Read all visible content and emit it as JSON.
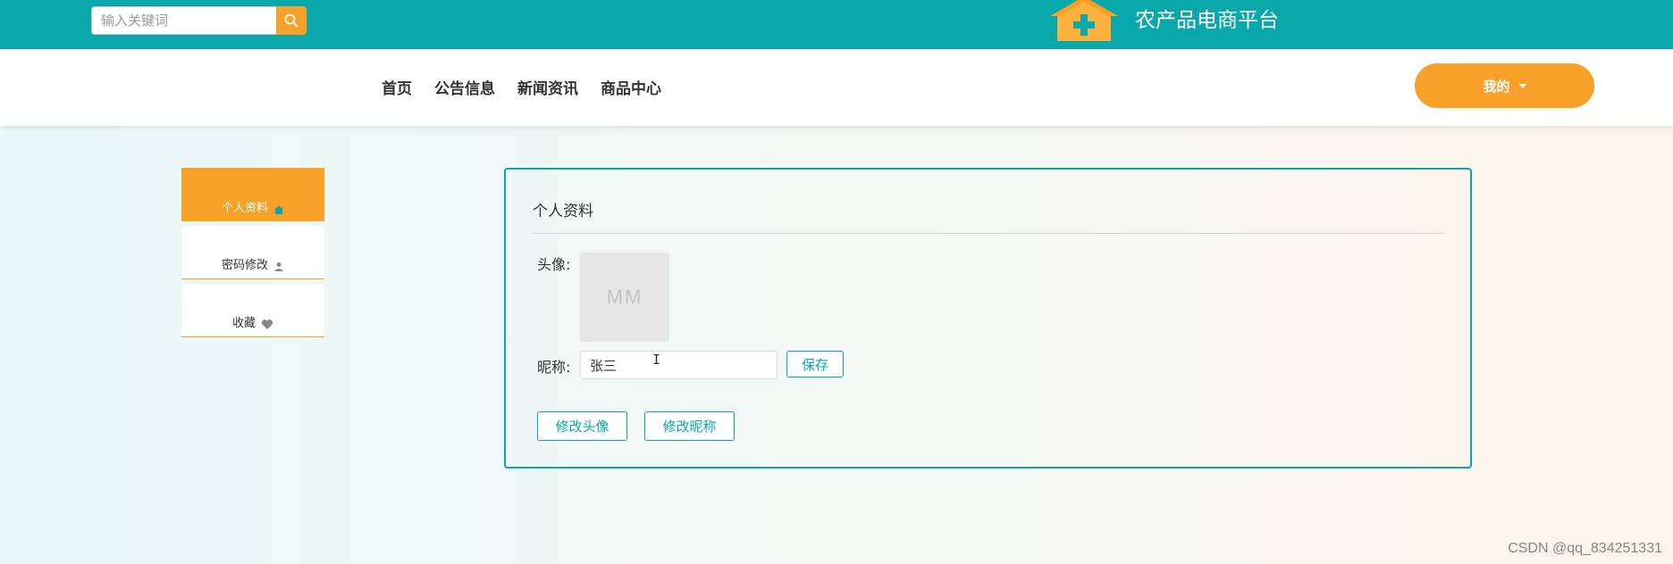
{
  "header": {
    "search_placeholder": "输入关键词",
    "search_icon": "search-icon",
    "logo_icon": "house-plus-logo",
    "site_title": "农产品电商平台"
  },
  "nav": {
    "items": [
      {
        "label": "首页"
      },
      {
        "label": "公告信息"
      },
      {
        "label": "新闻资讯"
      },
      {
        "label": "商品中心"
      }
    ],
    "user_menu_label": "我的"
  },
  "sidebar": {
    "items": [
      {
        "label": "个人资料",
        "icon": "home-icon",
        "active": true
      },
      {
        "label": "密码修改",
        "icon": "user-icon",
        "active": false
      },
      {
        "label": "收藏",
        "icon": "heart-icon",
        "active": false
      }
    ]
  },
  "profile": {
    "title": "个人资料",
    "avatar_label": "头像:",
    "avatar_initials": "MM",
    "nickname_label": "昵称:",
    "nickname_value": "张三",
    "save_label": "保存",
    "change_avatar_label": "修改头像",
    "change_nickname_label": "修改昵称"
  },
  "watermark": "CSDN @qq_834251331",
  "colors": {
    "primary_teal": "#0aa7ab",
    "accent_orange": "#f7a128"
  }
}
